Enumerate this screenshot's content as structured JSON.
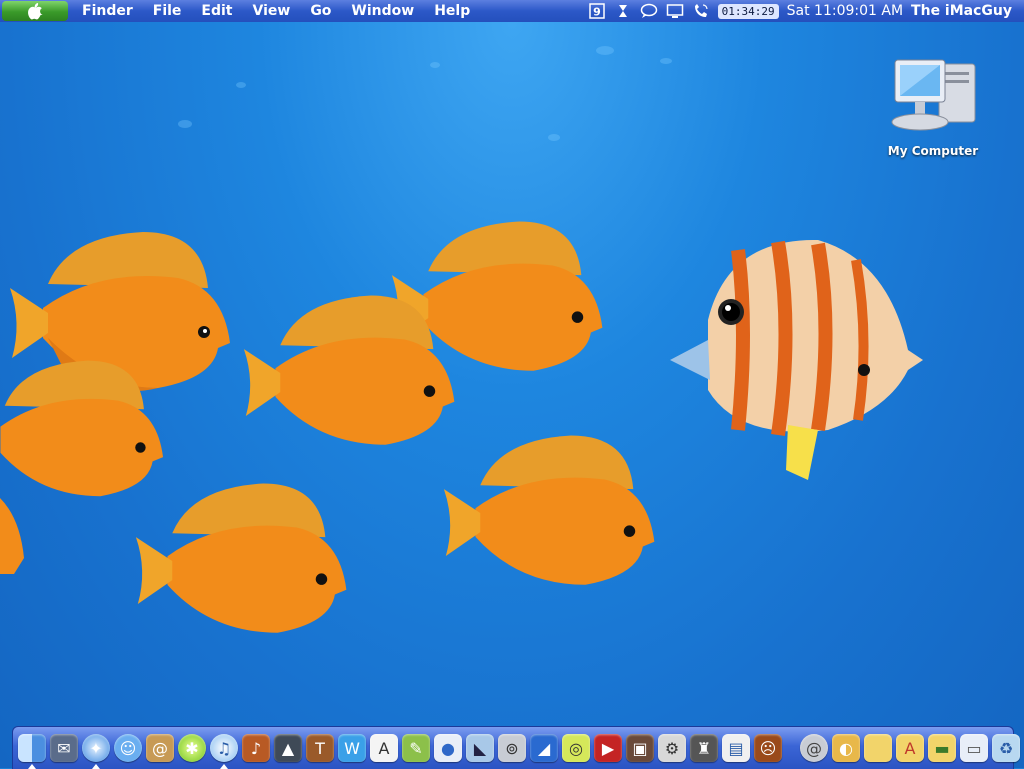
{
  "menubar": {
    "apple_menu": "apple-icon",
    "app_name": "Finder",
    "items": [
      "File",
      "Edit",
      "View",
      "Go",
      "Window",
      "Help"
    ],
    "status_icons": [
      "os9-icon",
      "script-icon",
      "ichat-icon",
      "display-icon",
      "phone-icon"
    ],
    "timer": "01:34:29",
    "clock": "Sat 11:09:01 AM",
    "user": "The iMacGuy",
    "bar_color": "#2c58c8",
    "apple_color": "#3a9a2a"
  },
  "desktop": {
    "background": "blue-ocean-with-orange-tang-fish-and-butterflyfish",
    "icons": [
      {
        "label": "My Computer",
        "icon": "computer-icon"
      }
    ]
  },
  "dock": {
    "apps": [
      {
        "icon": "finder-icon",
        "running": true
      },
      {
        "icon": "mail-stamp-icon",
        "running": false
      },
      {
        "icon": "safari-icon",
        "running": true
      },
      {
        "icon": "ichat-icon",
        "running": false
      },
      {
        "icon": "address-book-icon",
        "running": false
      },
      {
        "icon": "lime-icon",
        "running": false
      },
      {
        "icon": "itunes-icon",
        "running": true
      },
      {
        "icon": "guitar-icon",
        "running": false
      },
      {
        "icon": "iphoto-icon",
        "running": false
      },
      {
        "icon": "stool-icon",
        "running": false
      },
      {
        "icon": "writer-icon",
        "running": false
      },
      {
        "icon": "textedit-icon",
        "running": false
      },
      {
        "icon": "pencil-icon",
        "running": false
      },
      {
        "icon": "apple-store-icon",
        "running": false
      },
      {
        "icon": "preview-icon",
        "running": false
      },
      {
        "icon": "disk-utility-icon",
        "running": false
      },
      {
        "icon": "blue-book-icon",
        "running": false
      },
      {
        "icon": "cd-burn-icon",
        "running": false
      },
      {
        "icon": "race-car-icon",
        "running": false
      },
      {
        "icon": "photo-browser-icon",
        "running": false
      },
      {
        "icon": "system-profiler-icon",
        "running": false
      },
      {
        "icon": "hat-stand-icon",
        "running": false
      },
      {
        "icon": "pdf-doc-icon",
        "running": false
      },
      {
        "icon": "doom-icon",
        "running": false
      }
    ],
    "docs": [
      {
        "icon": "at-sign-icon"
      },
      {
        "icon": "globe-folder-icon"
      },
      {
        "icon": "folder-icon"
      },
      {
        "icon": "applications-folder-icon"
      },
      {
        "icon": "green-folder-icon"
      },
      {
        "icon": "window-icon"
      },
      {
        "icon": "trash-icon"
      }
    ]
  }
}
